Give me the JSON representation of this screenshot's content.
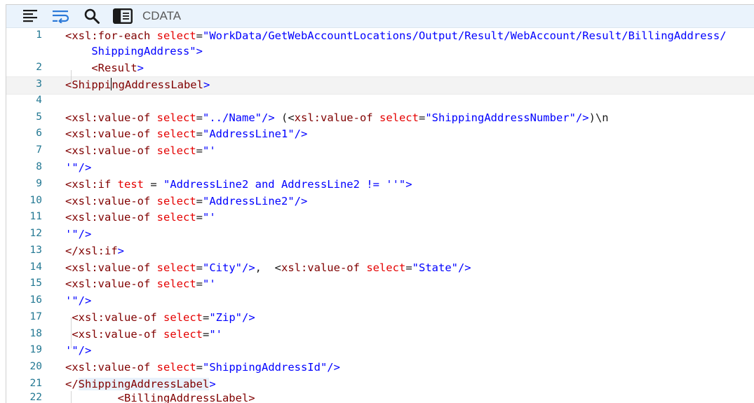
{
  "toolbar": {
    "format_icon": "align-left-icon",
    "wrap_icon": "word-wrap-icon",
    "search_icon": "search-icon",
    "panel_icon": "side-panel-icon",
    "label": "CDATA"
  },
  "colors": {
    "toolbar_bg": "#eaf3fc",
    "line_number": "#237893",
    "tag": "#800000",
    "attribute": "#e50000",
    "string": "#0000ff",
    "current_line": "#f3f3f3",
    "match_highlight": "#e8f1fb"
  },
  "current_line": 3,
  "lines": [
    {
      "n": "1",
      "segments": [
        [
          "tag",
          "<xsl:for-each "
        ],
        [
          "attr",
          "select"
        ],
        [
          "plain",
          "="
        ],
        [
          "str",
          "\"WorkData/GetWebAccountLocations/Output/Result/WebAccount/Result/BillingAddress/"
        ]
      ]
    },
    {
      "n": "",
      "segments": [
        [
          "str",
          "    ShippingAddress\""
        ],
        [
          "str",
          ">"
        ]
      ]
    },
    {
      "n": "2",
      "segments": [
        [
          "str",
          "    "
        ],
        [
          "tag",
          "<Result"
        ],
        [
          "str",
          ">"
        ]
      ]
    },
    {
      "n": "3",
      "segments": [
        [
          "tag",
          "<Shippi"
        ],
        [
          "caret",
          ""
        ],
        [
          "tag",
          "ngAddressLabel"
        ],
        [
          "str",
          ">"
        ]
      ]
    },
    {
      "n": "4",
      "segments": []
    },
    {
      "n": "5",
      "segments": [
        [
          "tag",
          "<xsl:value-of "
        ],
        [
          "attr",
          "select"
        ],
        [
          "plain",
          "="
        ],
        [
          "str",
          "\"../Name\"/>"
        ],
        [
          "plain",
          " (<"
        ],
        [
          "tag",
          "xsl:value-of "
        ],
        [
          "attr",
          "select"
        ],
        [
          "plain",
          "="
        ],
        [
          "str",
          "\"ShippingAddressNumber\"/>"
        ],
        [
          "plain",
          ")\\n"
        ]
      ]
    },
    {
      "n": "6",
      "segments": [
        [
          "tag",
          "<xsl:value-of "
        ],
        [
          "attr",
          "select"
        ],
        [
          "plain",
          "="
        ],
        [
          "str",
          "\"AddressLine1\"/>"
        ]
      ]
    },
    {
      "n": "7",
      "segments": [
        [
          "tag",
          "<xsl:value-of "
        ],
        [
          "attr",
          "select"
        ],
        [
          "plain",
          "="
        ],
        [
          "str",
          "\"'"
        ]
      ]
    },
    {
      "n": "8",
      "segments": [
        [
          "str",
          "'\"/>"
        ]
      ]
    },
    {
      "n": "9",
      "segments": [
        [
          "tag",
          "<xsl:if "
        ],
        [
          "attr",
          "test"
        ],
        [
          "plain",
          " = "
        ],
        [
          "str",
          "\"AddressLine2 and AddressLine2 != ''\">"
        ]
      ]
    },
    {
      "n": "10",
      "segments": [
        [
          "tag",
          "<xsl:value-of "
        ],
        [
          "attr",
          "select"
        ],
        [
          "plain",
          "="
        ],
        [
          "str",
          "\"AddressLine2\"/>"
        ]
      ]
    },
    {
      "n": "11",
      "segments": [
        [
          "tag",
          "<xsl:value-of "
        ],
        [
          "attr",
          "select"
        ],
        [
          "plain",
          "="
        ],
        [
          "str",
          "\"'"
        ]
      ]
    },
    {
      "n": "12",
      "segments": [
        [
          "str",
          "'\"/>"
        ]
      ]
    },
    {
      "n": "13",
      "segments": [
        [
          "tag",
          "</xsl:if"
        ],
        [
          "str",
          ">"
        ]
      ]
    },
    {
      "n": "14",
      "segments": [
        [
          "tag",
          "<xsl:value-of "
        ],
        [
          "attr",
          "select"
        ],
        [
          "plain",
          "="
        ],
        [
          "str",
          "\"City\"/>"
        ],
        [
          "plain",
          ",  <"
        ],
        [
          "tag",
          "xsl:value-of "
        ],
        [
          "attr",
          "select"
        ],
        [
          "plain",
          "="
        ],
        [
          "str",
          "\"State\"/>"
        ]
      ]
    },
    {
      "n": "15",
      "segments": [
        [
          "tag",
          "<xsl:value-of "
        ],
        [
          "attr",
          "select"
        ],
        [
          "plain",
          "="
        ],
        [
          "str",
          "\"'"
        ]
      ]
    },
    {
      "n": "16",
      "segments": [
        [
          "str",
          "'\"/>"
        ]
      ]
    },
    {
      "n": "17",
      "segments": [
        [
          "plain",
          " "
        ],
        [
          "tag",
          "<xsl:value-of "
        ],
        [
          "attr",
          "select"
        ],
        [
          "plain",
          "="
        ],
        [
          "str",
          "\"Zip\"/>"
        ]
      ]
    },
    {
      "n": "18",
      "segments": [
        [
          "plain",
          " "
        ],
        [
          "tag",
          "<xsl:value-of "
        ],
        [
          "attr",
          "select"
        ],
        [
          "plain",
          "="
        ],
        [
          "str",
          "\"'"
        ]
      ]
    },
    {
      "n": "19",
      "segments": [
        [
          "str",
          "'\"/>"
        ]
      ]
    },
    {
      "n": "20",
      "segments": [
        [
          "tag",
          "<xsl:value-of "
        ],
        [
          "attr",
          "select"
        ],
        [
          "plain",
          "="
        ],
        [
          "str",
          "\"ShippingAddressId\"/>"
        ]
      ]
    },
    {
      "n": "21",
      "segments": [
        [
          "tag",
          "</"
        ],
        [
          "hltag",
          "ShippingAddressLabel"
        ],
        [
          "str",
          ">"
        ]
      ]
    },
    {
      "n": "22",
      "segments": [
        [
          "plain",
          "        "
        ],
        [
          "tag",
          "<BillingAddressLabel>"
        ]
      ]
    }
  ]
}
